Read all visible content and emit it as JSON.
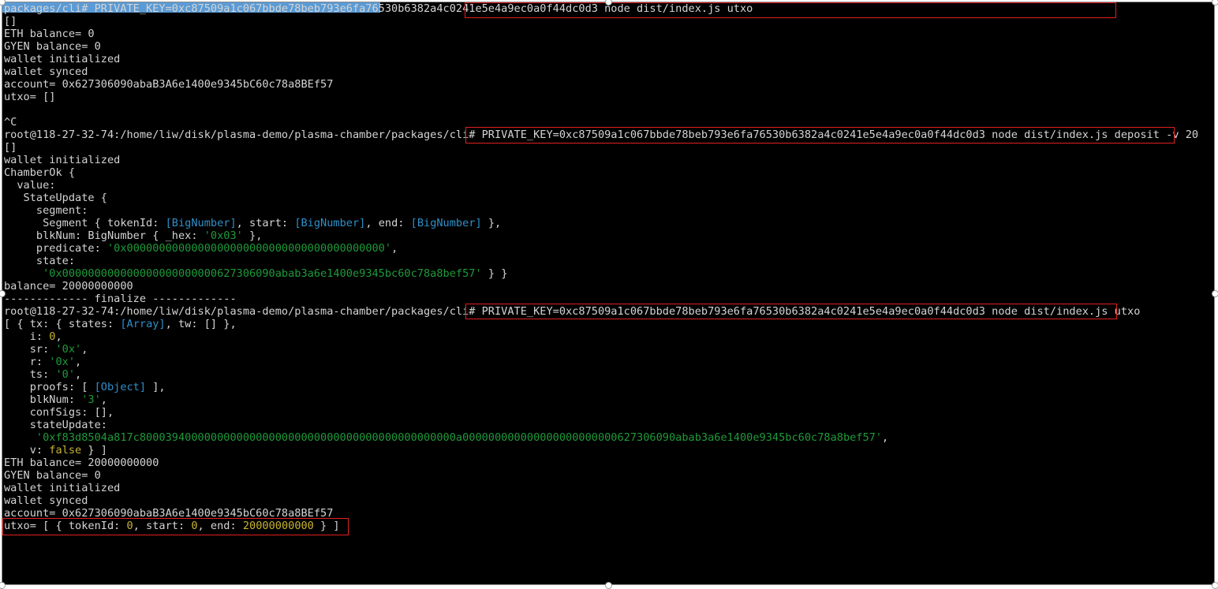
{
  "terminal": {
    "colors": {
      "background": "#000000",
      "text": "#d4d4d4",
      "string": "#1f9a3a",
      "object": "#2f8fc9",
      "number": "#c8b331",
      "highlight_box": "#e02020",
      "selection": "#5b9bd5"
    },
    "lines": [
      {
        "segments": [
          {
            "text": "packages/cli# PRIVATE_KEY=0xc87509a1c067bbde78beb793e6fa76530b6382a4c0241e5e4a9ec0a0f44dc0d3 node dist/index.js utxo",
            "color": "default"
          }
        ]
      },
      {
        "segments": [
          {
            "text": "[]",
            "color": "default"
          }
        ]
      },
      {
        "segments": [
          {
            "text": "ETH balance= 0",
            "color": "default"
          }
        ]
      },
      {
        "segments": [
          {
            "text": "GYEN balance= 0",
            "color": "default"
          }
        ]
      },
      {
        "segments": [
          {
            "text": "wallet initialized",
            "color": "default"
          }
        ]
      },
      {
        "segments": [
          {
            "text": "wallet synced",
            "color": "default"
          }
        ]
      },
      {
        "segments": [
          {
            "text": "account= 0x627306090abaB3A6e1400e9345bC60c78a8BEf57",
            "color": "default"
          }
        ]
      },
      {
        "segments": [
          {
            "text": "utxo= []",
            "color": "default"
          }
        ]
      },
      {
        "segments": [
          {
            "text": "",
            "color": "default"
          }
        ]
      },
      {
        "segments": [
          {
            "text": "^C",
            "color": "default"
          }
        ]
      },
      {
        "segments": [
          {
            "text": "root@118-27-32-74:/home/liw/disk/plasma-demo/plasma-chamber/packages/cli# PRIVATE_KEY=0xc87509a1c067bbde78beb793e6fa76530b6382a4c0241e5e4a9ec0a0f44dc0d3 node dist/index.js deposit -v 20",
            "color": "default"
          }
        ]
      },
      {
        "segments": [
          {
            "text": "[]",
            "color": "default"
          }
        ]
      },
      {
        "segments": [
          {
            "text": "wallet initialized",
            "color": "default"
          }
        ]
      },
      {
        "segments": [
          {
            "text": "ChamberOk {",
            "color": "default"
          }
        ]
      },
      {
        "segments": [
          {
            "text": "  value:",
            "color": "default"
          }
        ]
      },
      {
        "segments": [
          {
            "text": "   StateUpdate {",
            "color": "default"
          }
        ]
      },
      {
        "segments": [
          {
            "text": "     segment:",
            "color": "default"
          }
        ]
      },
      {
        "segments": [
          {
            "text": "      Segment { tokenId: ",
            "color": "default"
          },
          {
            "text": "[BigNumber]",
            "color": "blue"
          },
          {
            "text": ", start: ",
            "color": "default"
          },
          {
            "text": "[BigNumber]",
            "color": "blue"
          },
          {
            "text": ", end: ",
            "color": "default"
          },
          {
            "text": "[BigNumber]",
            "color": "blue"
          },
          {
            "text": " },",
            "color": "default"
          }
        ]
      },
      {
        "segments": [
          {
            "text": "     blkNum: BigNumber { _hex: ",
            "color": "default"
          },
          {
            "text": "'0x03'",
            "color": "green"
          },
          {
            "text": " },",
            "color": "default"
          }
        ]
      },
      {
        "segments": [
          {
            "text": "     predicate: ",
            "color": "default"
          },
          {
            "text": "'0x0000000000000000000000000000000000000000'",
            "color": "green"
          },
          {
            "text": ",",
            "color": "default"
          }
        ]
      },
      {
        "segments": [
          {
            "text": "     state:",
            "color": "default"
          }
        ]
      },
      {
        "segments": [
          {
            "text": "      ",
            "color": "default"
          },
          {
            "text": "'0x000000000000000000000000627306090abab3a6e1400e9345bc60c78a8bef57'",
            "color": "green"
          },
          {
            "text": " } }",
            "color": "default"
          }
        ]
      },
      {
        "segments": [
          {
            "text": "balance= 20000000000",
            "color": "default"
          }
        ]
      },
      {
        "segments": [
          {
            "text": "------------- finalize -------------",
            "color": "default"
          }
        ]
      },
      {
        "segments": [
          {
            "text": "root@118-27-32-74:/home/liw/disk/plasma-demo/plasma-chamber/packages/cli# PRIVATE_KEY=0xc87509a1c067bbde78beb793e6fa76530b6382a4c0241e5e4a9ec0a0f44dc0d3 node dist/index.js utxo",
            "color": "default"
          }
        ]
      },
      {
        "segments": [
          {
            "text": "[ { tx: { states: ",
            "color": "default"
          },
          {
            "text": "[Array]",
            "color": "blue"
          },
          {
            "text": ", tw: [] },",
            "color": "default"
          }
        ]
      },
      {
        "segments": [
          {
            "text": "    i: ",
            "color": "default"
          },
          {
            "text": "0",
            "color": "yellow"
          },
          {
            "text": ",",
            "color": "default"
          }
        ]
      },
      {
        "segments": [
          {
            "text": "    sr: ",
            "color": "default"
          },
          {
            "text": "'0x'",
            "color": "green"
          },
          {
            "text": ",",
            "color": "default"
          }
        ]
      },
      {
        "segments": [
          {
            "text": "    r: ",
            "color": "default"
          },
          {
            "text": "'0x'",
            "color": "green"
          },
          {
            "text": ",",
            "color": "default"
          }
        ]
      },
      {
        "segments": [
          {
            "text": "    ts: ",
            "color": "default"
          },
          {
            "text": "'0'",
            "color": "green"
          },
          {
            "text": ",",
            "color": "default"
          }
        ]
      },
      {
        "segments": [
          {
            "text": "    proofs: [ ",
            "color": "default"
          },
          {
            "text": "[Object]",
            "color": "blue"
          },
          {
            "text": " ],",
            "color": "default"
          }
        ]
      },
      {
        "segments": [
          {
            "text": "    blkNum: ",
            "color": "default"
          },
          {
            "text": "'3'",
            "color": "green"
          },
          {
            "text": ",",
            "color": "default"
          }
        ]
      },
      {
        "segments": [
          {
            "text": "    confSigs: [],",
            "color": "default"
          }
        ]
      },
      {
        "segments": [
          {
            "text": "    stateUpdate:",
            "color": "default"
          }
        ]
      },
      {
        "segments": [
          {
            "text": "     ",
            "color": "default"
          },
          {
            "text": "'0xf83d8504a817c8000394000000000000000000000000000000000000000000a000000000000000000000000627306090abab3a6e1400e9345bc60c78a8bef57'",
            "color": "green"
          },
          {
            "text": ",",
            "color": "default"
          }
        ]
      },
      {
        "segments": [
          {
            "text": "    v: ",
            "color": "default"
          },
          {
            "text": "false",
            "color": "yellow"
          },
          {
            "text": " } ]",
            "color": "default"
          }
        ]
      },
      {
        "segments": [
          {
            "text": "ETH balance= 20000000000",
            "color": "default"
          }
        ]
      },
      {
        "segments": [
          {
            "text": "GYEN balance= 0",
            "color": "default"
          }
        ]
      },
      {
        "segments": [
          {
            "text": "wallet initialized",
            "color": "default"
          }
        ]
      },
      {
        "segments": [
          {
            "text": "wallet synced",
            "color": "default"
          }
        ]
      },
      {
        "segments": [
          {
            "text": "account= 0x627306090abaB3A6e1400e9345bC60c78a8BEf57",
            "color": "default"
          }
        ]
      },
      {
        "segments": [
          {
            "text": "utxo= [ { tokenId: ",
            "color": "default"
          },
          {
            "text": "0",
            "color": "yellow"
          },
          {
            "text": ", start: ",
            "color": "default"
          },
          {
            "text": "0",
            "color": "yellow"
          },
          {
            "text": ", end: ",
            "color": "default"
          },
          {
            "text": "20000000000",
            "color": "yellow"
          },
          {
            "text": " } ]",
            "color": "default"
          }
        ]
      }
    ]
  }
}
